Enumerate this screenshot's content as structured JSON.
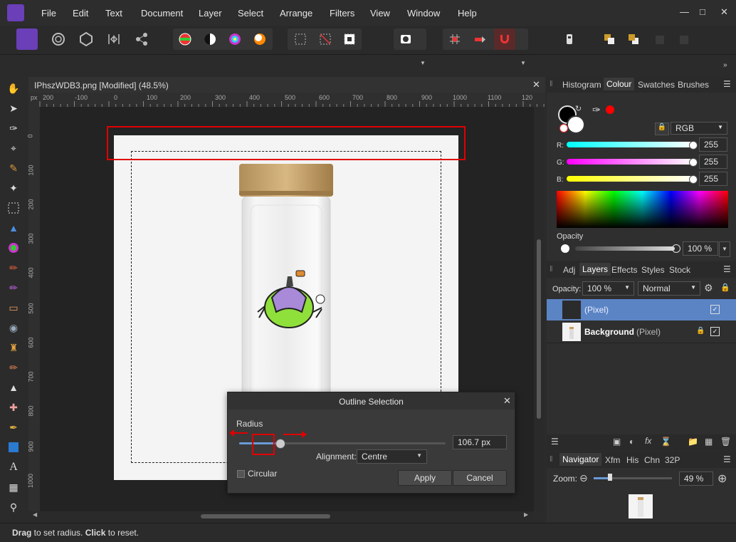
{
  "menu": [
    "File",
    "Edit",
    "Text",
    "Document",
    "Layer",
    "Select",
    "Arrange",
    "Filters",
    "View",
    "Window",
    "Help"
  ],
  "document": {
    "tab_title": "IPhszWDB3.png [Modified] (48.5%)",
    "ruler_unit": "px",
    "ruler_x": [
      "200",
      "-100",
      "0",
      "100",
      "200",
      "300",
      "400",
      "500",
      "600",
      "700",
      "800",
      "900",
      "1000",
      "1100",
      "120"
    ],
    "ruler_y": [
      "0",
      "100",
      "200",
      "300",
      "400",
      "500",
      "600",
      "700",
      "800",
      "900",
      "1000"
    ]
  },
  "dialog": {
    "title": "Outline Selection",
    "radius_label": "Radius",
    "radius_value": "106.7 px",
    "radius_fraction": 0.2,
    "alignment_label": "Alignment:",
    "alignment_value": "Centre",
    "circular_label": "Circular",
    "apply_label": "Apply",
    "cancel_label": "Cancel"
  },
  "colour_panel": {
    "tabs": [
      "Histogram",
      "Colour",
      "Swatches",
      "Brushes"
    ],
    "active_tab": "Colour",
    "model": "RGB",
    "r_label": "R:",
    "r_value": "255",
    "g_label": "G:",
    "g_value": "255",
    "b_label": "B:",
    "b_value": "255",
    "opacity_label": "Opacity",
    "opacity_value": "100 %"
  },
  "layers_panel": {
    "tabs": [
      "Adj",
      "Layers",
      "Effects",
      "Styles",
      "Stock"
    ],
    "active_tab": "Layers",
    "opacity_label": "Opacity:",
    "opacity_value": "100 %",
    "blend_mode": "Normal",
    "layers": [
      {
        "name": "",
        "type": "(Pixel)",
        "selected": true
      },
      {
        "name": "Background",
        "type": "(Pixel)",
        "selected": false
      }
    ]
  },
  "navigator_panel": {
    "tabs": [
      "Navigator",
      "Xfm",
      "His",
      "Chn",
      "32P"
    ],
    "active_tab": "Navigator",
    "zoom_label": "Zoom:",
    "zoom_value": "49 %"
  },
  "status": {
    "drag_bold": "Drag",
    "drag_text": " to set radius. ",
    "click_bold": "Click",
    "click_text": " to reset."
  },
  "colors": {
    "accent": "#5b84c4",
    "highlight_red": "#e00000"
  }
}
